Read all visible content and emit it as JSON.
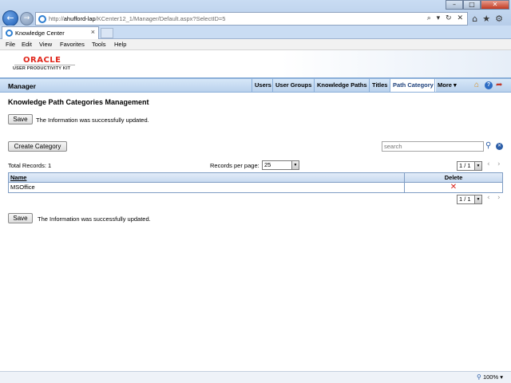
{
  "browser": {
    "url_prefix": "http://",
    "url_host": "ahufford-lap",
    "url_path": "/KCenter12_1/Manager/Default.aspx?SelectID=5",
    "address_tools": "⌕ ▾ ↻ ✕",
    "tab_label": "Knowledge Center",
    "tab_close": "×",
    "menus": [
      "File",
      "Edit",
      "View",
      "Favorites",
      "Tools",
      "Help"
    ],
    "zoom": "100%"
  },
  "brand": {
    "logo": "ORACLE",
    "product": "USER PRODUCTIVITY KIT"
  },
  "nav": {
    "section": "Manager",
    "links": [
      "Users",
      "User Groups",
      "Knowledge Paths",
      "Titles",
      "Path Category",
      "More ▾"
    ],
    "active": "Path Category"
  },
  "page": {
    "title": "Knowledge Path Categories Management",
    "save_label": "Save",
    "success_message": "The Information was successfully updated.",
    "create_label": "Create Category",
    "search_placeholder": "search",
    "total_records": "Total Records: 1",
    "records_per_page_label": "Records per page:",
    "records_per_page_value": "25",
    "pager_value": "1 / 1"
  },
  "table": {
    "columns": [
      "Name",
      "Delete"
    ],
    "rows": [
      {
        "name": "MSOffice",
        "delete": "✕"
      }
    ]
  }
}
